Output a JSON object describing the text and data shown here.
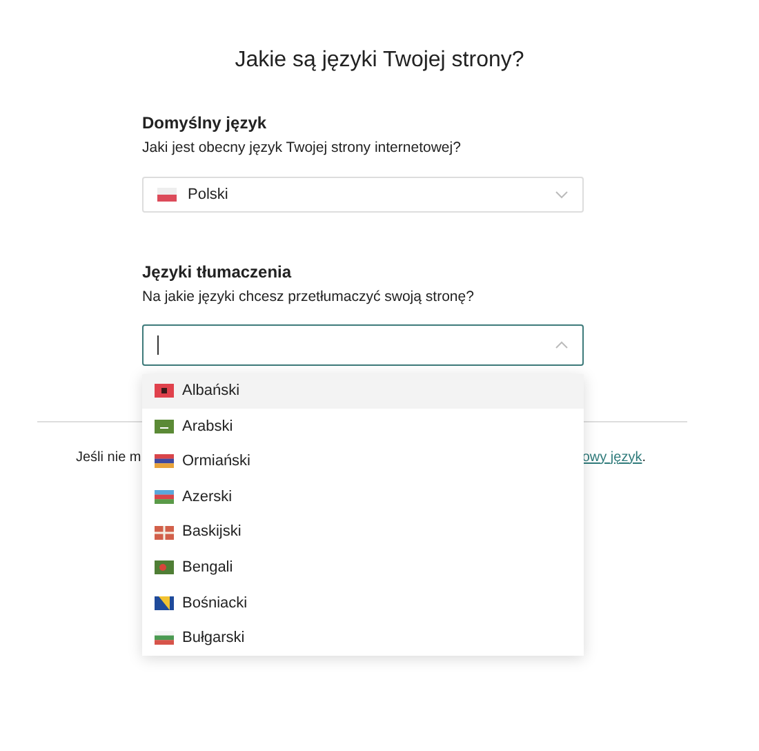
{
  "title": "Jakie są języki Twojej strony?",
  "default_language": {
    "label": "Domyślny język",
    "hint": "Jaki jest obecny język Twojej strony internetowej?",
    "value": "Polski"
  },
  "translation_languages": {
    "label": "Języki tłumaczenia",
    "hint": "Na jakie języki chcesz przetłumaczyć swoją stronę?",
    "expanded": true,
    "options": [
      {
        "label": "Albański",
        "selected": true
      },
      {
        "label": "Arabski",
        "selected": false
      },
      {
        "label": "Ormiański",
        "selected": false
      },
      {
        "label": "Azerski",
        "selected": false
      },
      {
        "label": "Baskijski",
        "selected": false
      },
      {
        "label": "Bengali",
        "selected": false
      },
      {
        "label": "Bośniacki",
        "selected": false
      },
      {
        "label": "Bułgarski",
        "selected": false
      }
    ]
  },
  "footer": {
    "text_start": "Jeśli nie m",
    "link": "owy język",
    "text_end": "."
  }
}
